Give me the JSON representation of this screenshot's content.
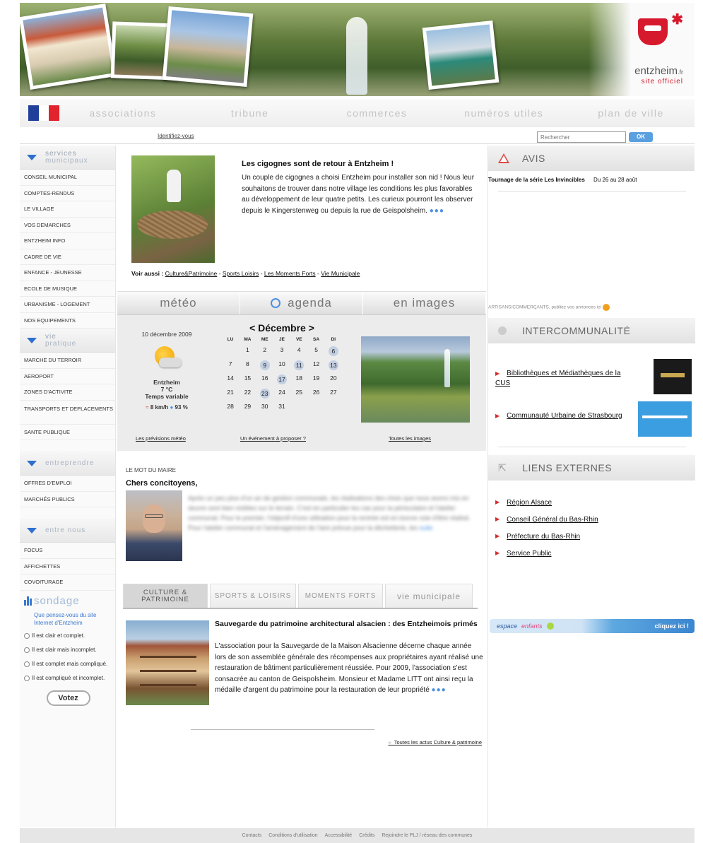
{
  "header": {
    "logo_name": "entzheim",
    "logo_suffix": ".fr",
    "logo_tagline": "site officiel",
    "colors": {
      "brand_red": "#d7192e",
      "accent_blue": "#2f6fcf"
    }
  },
  "nav": {
    "items": [
      "associations",
      "tribune",
      "commerces",
      "numéros utiles",
      "plan de ville"
    ],
    "login_link": "Identifiez-vous",
    "search_placeholder": "Rechercher",
    "search_button": "OK"
  },
  "sidebar": {
    "services_title_1": "services",
    "services_title_2": "municipaux",
    "services_items": [
      "CONSEIL MUNICIPAL",
      "COMPTES-RENDUS",
      "LE VILLAGE",
      "VOS DEMARCHES",
      "ENTZHEIM INFO",
      "CADRE DE VIE",
      "ENFANCE - JEUNESSE",
      "ECOLE DE MUSIQUE",
      "URBANISME - LOGEMENT",
      "NOS EQUIPEMENTS"
    ],
    "vie_title_1": "vie",
    "vie_title_2": "pratique",
    "vie_items": [
      "MARCHE DU TERROIR",
      "AEROPORT",
      "ZONES D'ACTIVITE",
      "TRANSPORTS ET DEPLACEMENTS",
      "SANTE PUBLIQUE"
    ],
    "entreprise_title": "entreprendre",
    "entreprise_items": [
      "OFFRES D'EMPLOI",
      "MARCHÉS PUBLICS"
    ],
    "entre_title": "entre nous",
    "entre_items": [
      "FOCUS",
      "AFFICHETTES",
      "COVOITURAGE"
    ],
    "sondage": {
      "title": "sondage",
      "question": "Que pensez-vous du site Internet d'Entzheim",
      "options": [
        "Il est clair et complet.",
        "Il est clair mais incomplet.",
        "Il est complet mais compliqué.",
        "Il est compliqué et incomplet."
      ],
      "vote_button": "Votez"
    }
  },
  "feature": {
    "title": "Les cigognes sont de retour à Entzheim !",
    "text": "Un couple de cigognes a choisi Entzheim pour installer son nid ! Nous leur souhaitons de trouver dans notre village les conditions les plus favorables au développement de leur quatre petits. Les curieux pourront les observer depuis le Kingerstenweg ou depuis la rue de Geispolsheim.",
    "more": "●●●",
    "see_also_label": "Voir aussi :",
    "see_also_links": [
      "Culture&Patrimoine",
      "Sports Loisirs",
      "Les Moments Forts",
      "Vie Municipale"
    ],
    "see_also_sep": " - "
  },
  "widget_tabs": [
    "météo",
    "agenda",
    "en images"
  ],
  "meteo": {
    "date": "10 décembre 2009",
    "city": "Entzheim",
    "temp": "7 °C",
    "condition": "Temps variable",
    "wind": "8 km/h",
    "humidity": "93 %",
    "link": "Les prévisions météo"
  },
  "calendar": {
    "month": "< Décembre >",
    "days_of_week": [
      "LU",
      "MA",
      "ME",
      "JE",
      "VE",
      "SA",
      "DI"
    ],
    "weeks": [
      [
        "",
        "1",
        "2",
        "3",
        "4",
        "5",
        "6"
      ],
      [
        "7",
        "8",
        "9",
        "10",
        "11",
        "12",
        "13"
      ],
      [
        "14",
        "15",
        "16",
        "17",
        "18",
        "19",
        "20"
      ],
      [
        "21",
        "22",
        "23",
        "24",
        "25",
        "26",
        "27"
      ],
      [
        "28",
        "29",
        "30",
        "31",
        "",
        "",
        ""
      ]
    ],
    "highlighted": [
      "6",
      "9",
      "11",
      "13",
      "17",
      "23"
    ],
    "link": "Un événement à proposer ?"
  },
  "images": {
    "link": "Toutes les images"
  },
  "maire": {
    "label": "LE MOT DU MAIRE",
    "title": "Chers concitoyens,",
    "text": "Après un peu plus d'un an de gestion communale, les réalisations des choix que nous avons mis en œuvre sont bien visibles sur le terrain. C'est en particulier les cas pour la périscolaire et l'atelier communal. Pour le premier, l'objectif d'une utilisation pour la rentrée est en bonne voie d'être réalisé. Pour l'atelier communal et l'aménagement de l'aire prévue pour la déchetterie, les",
    "more": "suite"
  },
  "section_tabs": [
    {
      "label": "CULTURE & PATRIMOINE"
    },
    {
      "label": "SPORTS & LOISIRS"
    },
    {
      "label": "MOMENTS FORTS"
    },
    {
      "label": "vie municipale"
    }
  ],
  "patrimoine": {
    "title": "Sauvegarde du patrimoine architectural alsacien : des Entzheimois primés",
    "text": "L'association pour la Sauvegarde de la Maison Alsacienne décerne chaque année lors de son assemblée générale des récompenses aux propriétaires ayant réalisé une restauration de bâtiment particulièrement réussiée. Pour 2009, l'association s'est consacrée au canton de Geispolsheim. Monsieur et Madame LITT ont ainsi reçu la médaille d'argent du patrimoine pour la restauration de leur propriété",
    "more": "●●●",
    "all_link": "Toutes les actus Culture & patrimoine"
  },
  "avis": {
    "title": "AVIS",
    "item_title": "Tournage de la série Les Invincibles",
    "item_date": "Du 26 au 28 août",
    "artisans": "ARTISANS/COMMERÇANTS, publiez vos annonces ici"
  },
  "inter": {
    "title": "INTERCOMMUNALITÉ",
    "items": [
      "Bibliothèques et Médiathèques de la CUS",
      "Communauté Urbaine de Strasbourg"
    ]
  },
  "liens": {
    "title": "LIENS EXTERNES",
    "items": [
      "Région Alsace",
      "Conseil Général du Bas-Rhin",
      "Préfecture du Bas-Rhin",
      "Service Public"
    ]
  },
  "espace": {
    "part1": "espace",
    "part2": "enfants",
    "cta": "cliquez ici !"
  },
  "footer": {
    "links": [
      "Contacts",
      "Conditions d'utilisation",
      "Accessibilité",
      "Crédits",
      "Rejoindre le PLJ / réseau des communes"
    ]
  }
}
